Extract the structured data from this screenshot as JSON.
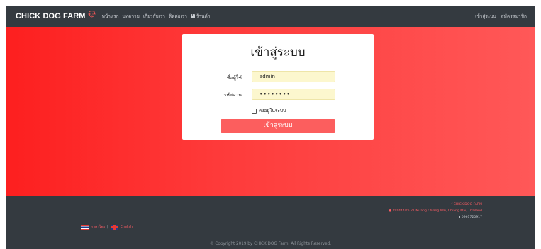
{
  "navbar": {
    "brand": "CHICK DOG FARM",
    "links": [
      {
        "label": "หน้าแรก"
      },
      {
        "label": "บทความ"
      },
      {
        "label": "เกี่ยวกับเรา"
      },
      {
        "label": "ติดต่อเรา"
      },
      {
        "label": "ร้านค้า"
      }
    ],
    "right_links": [
      {
        "label": "เข้าสู่ระบบ"
      },
      {
        "label": "สมัครสมาชิก"
      }
    ]
  },
  "login": {
    "title": "เข้าสู่ระบบ",
    "username_label": "ชื่อผู้ใช้",
    "username_value": "admin",
    "password_label": "รหัสผ่าน",
    "password_value": "••••••••",
    "remember_label": "คงอยู่ในระบบ",
    "submit_label": "เข้าสู่ระบบ"
  },
  "footer": {
    "facebook": "CHICK DOG FARM",
    "address": "ถนนนิมมาน 21 Muang Chiang Mai, Chiang Mai, Thailand",
    "phone": "0961720917",
    "lang_th": "ภาษาไทย",
    "lang_separator": "|",
    "lang_en": "English",
    "copyright": "© Copyright 2019 by CHICK DOG Farm. All Rights Reserved."
  },
  "colors": {
    "navbar_bg": "#343a40",
    "hero_start": "#fd1f1f",
    "hero_end": "#ff5858",
    "button": "#fc5e5e",
    "input_bg": "#fcf7ce",
    "footer_accent": "#fd5c63"
  }
}
